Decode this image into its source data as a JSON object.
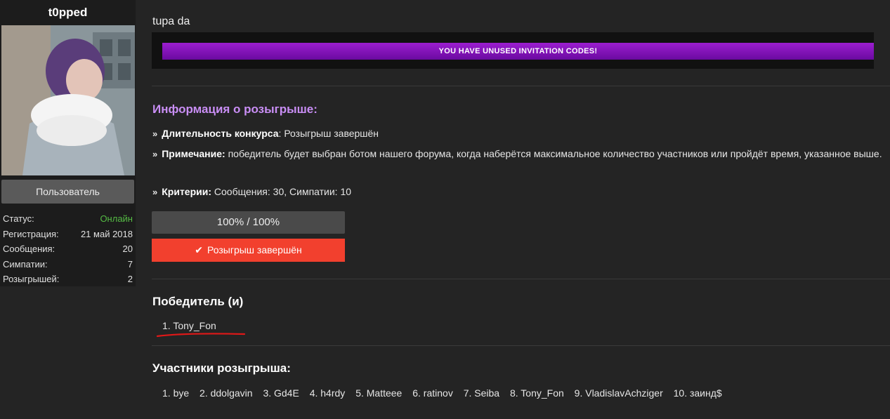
{
  "user": {
    "name": "t0pped",
    "role_label": "Пользователь",
    "stats": [
      {
        "label": "Статус:",
        "value": "Онлайн"
      },
      {
        "label": "Регистрация:",
        "value": "21 май 2018"
      },
      {
        "label": "Сообщения:",
        "value": "20"
      },
      {
        "label": "Симпатии:",
        "value": "7"
      },
      {
        "label": "Розыгрышей:",
        "value": "2"
      }
    ]
  },
  "post": {
    "title": "tupa da",
    "invite_notice": "YOU HAVE UNUSED INVITATION CODES!"
  },
  "giveaway": {
    "info_title": "Информация о розыгрыше:",
    "duration_label": "Длительность конкурса",
    "duration_value": ": Розыгрыш завершён",
    "note_label": "Примечание:",
    "note_value": " победитель будет выбран ботом нашего форума, когда наберётся максимальное количество участников или пройдёт время, указанное выше.",
    "criteria_label": "Критерии:",
    "criteria_value": " Сообщения: 30, Симпатии: 10",
    "progress_text": "100% / 100%",
    "progress_percent": 100,
    "status_button": "Розыгрыш завершён",
    "winners_title": "Победитель (и)",
    "winners": [
      "1. Tony_Fon"
    ],
    "participants_title": "Участники розыгрыша:",
    "participants": [
      "1. bye",
      "2. ddolgavin",
      "3. Gd4E",
      "4. h4rdy",
      "5. Matteee",
      "6. ratinov",
      "7. Seiba",
      "8. Tony_Fon",
      "9. VladislavAchziger",
      "10. заинд$"
    ]
  },
  "colors": {
    "accent_purple": "#c98ef5",
    "invite_bar": "#8a14c0",
    "done_button": "#f2402e",
    "online": "#55bb44"
  }
}
